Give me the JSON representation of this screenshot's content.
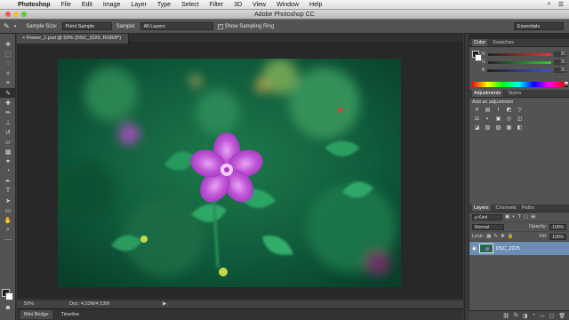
{
  "menubar": {
    "apple_icon": "apple-logo-icon",
    "app_name": "Photoshop",
    "items": [
      "File",
      "Edit",
      "Image",
      "Layer",
      "Type",
      "Select",
      "Filter",
      "3D",
      "View",
      "Window",
      "Help"
    ]
  },
  "window": {
    "title": "Adobe Photoshop CC"
  },
  "options_bar": {
    "tool_icon": "eyedropper-icon",
    "sample_size_label": "Sample Size:",
    "sample_size_value": "Point Sample",
    "sample_label": "Sample:",
    "sample_value": "All Layers",
    "show_ring_label": "Show Sampling Ring",
    "show_ring_checked": true,
    "workspace": "Essentials"
  },
  "document": {
    "tab_title": "Flower_1.psd @ 50% (DSC_2225, RGB/8*)",
    "close_glyph": "×"
  },
  "status": {
    "zoom": "50%",
    "doc_size": "Doc: 4.53M/4.53M",
    "arrow": "▶"
  },
  "bottom_tabs": [
    "Mini Bridge",
    "Timeline"
  ],
  "color_panel": {
    "tabs": [
      "Color",
      "Swatches"
    ],
    "channels": [
      {
        "label": "R",
        "value": "35",
        "color": "#cc3030"
      },
      {
        "label": "G",
        "value": "35",
        "color": "#30b040"
      },
      {
        "label": "B",
        "value": "35",
        "color": "#3050d0"
      }
    ]
  },
  "adjustments_panel": {
    "tabs": [
      "Adjustments",
      "Styles"
    ],
    "label": "Add an adjustment",
    "icons": [
      "☀",
      "▤",
      "⌇",
      "◩",
      "▽",
      "",
      "",
      "",
      "⚖",
      "◐",
      "▣",
      "◎",
      "◫",
      "",
      "",
      "",
      "◪",
      "▧",
      "▨",
      "▦",
      "◧",
      "",
      "",
      ""
    ]
  },
  "layers_panel": {
    "tabs": [
      "Layers",
      "Channels",
      "Paths"
    ],
    "kind": "ρ Kind",
    "blend_mode": "Normal",
    "opacity_label": "Opacity:",
    "opacity": "100%",
    "lock_label": "Lock:",
    "fill_label": "Fill:",
    "fill": "100%",
    "layer_name": "DSC_2225",
    "footer_icons": [
      "⛓",
      "fx",
      "◨",
      "◔",
      "▭",
      "▢",
      "🗑"
    ]
  },
  "colors": {
    "accent": "#6d8eb2",
    "foreground": "#1b1b1b",
    "background": "#ffffff"
  }
}
